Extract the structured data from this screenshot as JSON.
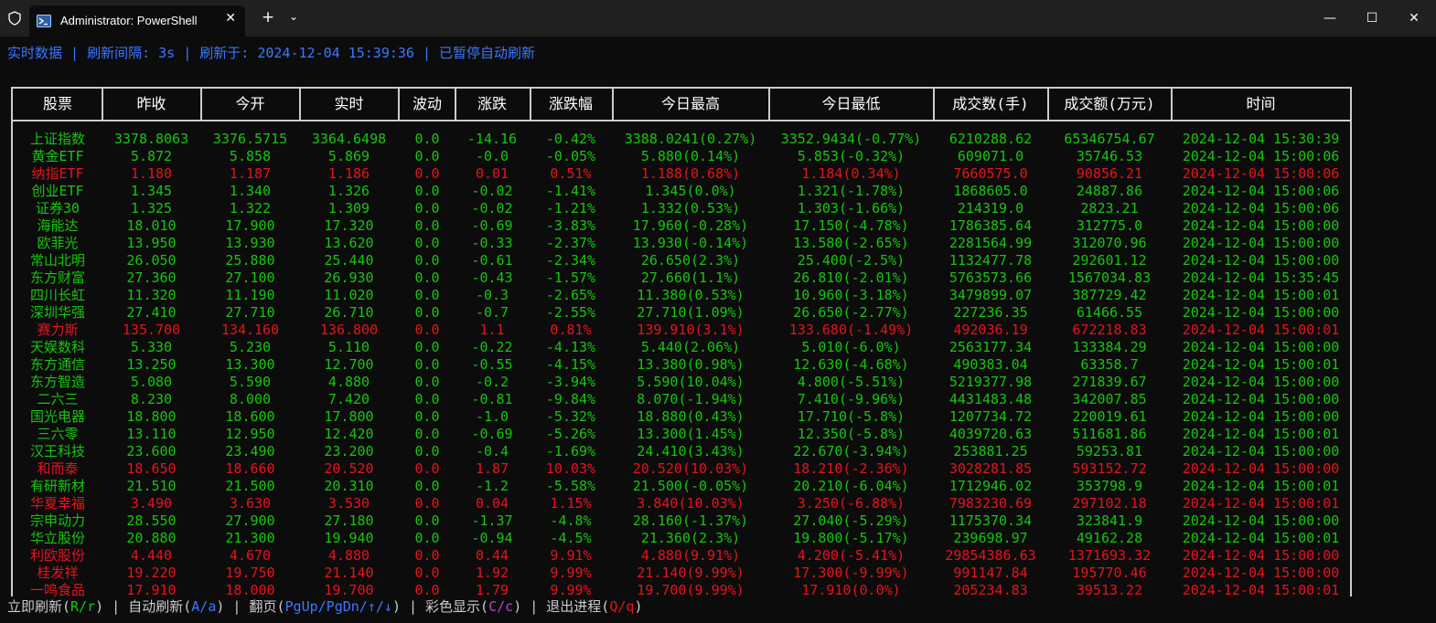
{
  "window": {
    "tab_title": "Administrator: PowerShell",
    "close_tab": "✕",
    "new_tab": "+",
    "dropdown": "⌄",
    "minimize": "—",
    "maximize": "☐",
    "close": "✕",
    "icons": [
      "shield-icon",
      "powershell-icon"
    ]
  },
  "status": {
    "text": "实时数据 | 刷新间隔: 3s | 刷新于: 2024-12-04 15:39:36 | 已暂停自动刷新"
  },
  "colors": {
    "up": "#e5141b",
    "down": "#16c60c",
    "info": "#3b78ff",
    "hotkey_color": "#b148c6"
  },
  "table": {
    "headers": [
      "股票",
      "昨收",
      "今开",
      "实时",
      "波动",
      "涨跌",
      "涨跌幅",
      "今日最高",
      "今日最低",
      "成交数(手)",
      "成交额(万元)",
      "时间"
    ],
    "rows": [
      {
        "trend": "down",
        "cells": [
          "上证指数",
          "3378.8063",
          "3376.5715",
          "3364.6498",
          "0.0",
          "-14.16",
          "-0.42%",
          "3388.0241(0.27%)",
          "3352.9434(-0.77%)",
          "6210288.62",
          "65346754.67",
          "2024-12-04 15:30:39"
        ]
      },
      {
        "trend": "down",
        "cells": [
          "黄金ETF",
          "5.872",
          "5.858",
          "5.869",
          "0.0",
          "-0.0",
          "-0.05%",
          "5.880(0.14%)",
          "5.853(-0.32%)",
          "609071.0",
          "35746.53",
          "2024-12-04 15:00:06"
        ]
      },
      {
        "trend": "up",
        "cells": [
          "纳指ETF",
          "1.180",
          "1.187",
          "1.186",
          "0.0",
          "0.01",
          "0.51%",
          "1.188(0.68%)",
          "1.184(0.34%)",
          "7660575.0",
          "90856.21",
          "2024-12-04 15:00:06"
        ]
      },
      {
        "trend": "down",
        "cells": [
          "创业ETF",
          "1.345",
          "1.340",
          "1.326",
          "0.0",
          "-0.02",
          "-1.41%",
          "1.345(0.0%)",
          "1.321(-1.78%)",
          "1868605.0",
          "24887.86",
          "2024-12-04 15:00:06"
        ]
      },
      {
        "trend": "down",
        "cells": [
          "证券30",
          "1.325",
          "1.322",
          "1.309",
          "0.0",
          "-0.02",
          "-1.21%",
          "1.332(0.53%)",
          "1.303(-1.66%)",
          "214319.0",
          "2823.21",
          "2024-12-04 15:00:06"
        ]
      },
      {
        "trend": "down",
        "cells": [
          "海能达",
          "18.010",
          "17.900",
          "17.320",
          "0.0",
          "-0.69",
          "-3.83%",
          "17.960(-0.28%)",
          "17.150(-4.78%)",
          "1786385.64",
          "312775.0",
          "2024-12-04 15:00:00"
        ]
      },
      {
        "trend": "down",
        "cells": [
          "欧菲光",
          "13.950",
          "13.930",
          "13.620",
          "0.0",
          "-0.33",
          "-2.37%",
          "13.930(-0.14%)",
          "13.580(-2.65%)",
          "2281564.99",
          "312070.96",
          "2024-12-04 15:00:00"
        ]
      },
      {
        "trend": "down",
        "cells": [
          "常山北明",
          "26.050",
          "25.880",
          "25.440",
          "0.0",
          "-0.61",
          "-2.34%",
          "26.650(2.3%)",
          "25.400(-2.5%)",
          "1132477.78",
          "292601.12",
          "2024-12-04 15:00:00"
        ]
      },
      {
        "trend": "down",
        "cells": [
          "东方财富",
          "27.360",
          "27.100",
          "26.930",
          "0.0",
          "-0.43",
          "-1.57%",
          "27.660(1.1%)",
          "26.810(-2.01%)",
          "5763573.66",
          "1567034.83",
          "2024-12-04 15:35:45"
        ]
      },
      {
        "trend": "down",
        "cells": [
          "四川长虹",
          "11.320",
          "11.190",
          "11.020",
          "0.0",
          "-0.3",
          "-2.65%",
          "11.380(0.53%)",
          "10.960(-3.18%)",
          "3479899.07",
          "387729.42",
          "2024-12-04 15:00:01"
        ]
      },
      {
        "trend": "down",
        "cells": [
          "深圳华强",
          "27.410",
          "27.710",
          "26.710",
          "0.0",
          "-0.7",
          "-2.55%",
          "27.710(1.09%)",
          "26.650(-2.77%)",
          "227236.35",
          "61466.55",
          "2024-12-04 15:00:00"
        ]
      },
      {
        "trend": "up",
        "cells": [
          "赛力斯",
          "135.700",
          "134.160",
          "136.800",
          "0.0",
          "1.1",
          "0.81%",
          "139.910(3.1%)",
          "133.680(-1.49%)",
          "492036.19",
          "672218.83",
          "2024-12-04 15:00:01"
        ]
      },
      {
        "trend": "down",
        "cells": [
          "天娱数科",
          "5.330",
          "5.230",
          "5.110",
          "0.0",
          "-0.22",
          "-4.13%",
          "5.440(2.06%)",
          "5.010(-6.0%)",
          "2563177.34",
          "133384.29",
          "2024-12-04 15:00:00"
        ]
      },
      {
        "trend": "down",
        "cells": [
          "东方通信",
          "13.250",
          "13.300",
          "12.700",
          "0.0",
          "-0.55",
          "-4.15%",
          "13.380(0.98%)",
          "12.630(-4.68%)",
          "490383.04",
          "63358.7",
          "2024-12-04 15:00:01"
        ]
      },
      {
        "trend": "down",
        "cells": [
          "东方智造",
          "5.080",
          "5.590",
          "4.880",
          "0.0",
          "-0.2",
          "-3.94%",
          "5.590(10.04%)",
          "4.800(-5.51%)",
          "5219377.98",
          "271839.67",
          "2024-12-04 15:00:00"
        ]
      },
      {
        "trend": "down",
        "cells": [
          "二六三",
          "8.230",
          "8.000",
          "7.420",
          "0.0",
          "-0.81",
          "-9.84%",
          "8.070(-1.94%)",
          "7.410(-9.96%)",
          "4431483.48",
          "342007.85",
          "2024-12-04 15:00:00"
        ]
      },
      {
        "trend": "down",
        "cells": [
          "国光电器",
          "18.800",
          "18.600",
          "17.800",
          "0.0",
          "-1.0",
          "-5.32%",
          "18.880(0.43%)",
          "17.710(-5.8%)",
          "1207734.72",
          "220019.61",
          "2024-12-04 15:00:00"
        ]
      },
      {
        "trend": "down",
        "cells": [
          "三六零",
          "13.110",
          "12.950",
          "12.420",
          "0.0",
          "-0.69",
          "-5.26%",
          "13.300(1.45%)",
          "12.350(-5.8%)",
          "4039720.63",
          "511681.86",
          "2024-12-04 15:00:01"
        ]
      },
      {
        "trend": "down",
        "cells": [
          "汉王科技",
          "23.600",
          "23.490",
          "23.200",
          "0.0",
          "-0.4",
          "-1.69%",
          "24.410(3.43%)",
          "22.670(-3.94%)",
          "253881.25",
          "59253.81",
          "2024-12-04 15:00:00"
        ]
      },
      {
        "trend": "up",
        "cells": [
          "和而泰",
          "18.650",
          "18.660",
          "20.520",
          "0.0",
          "1.87",
          "10.03%",
          "20.520(10.03%)",
          "18.210(-2.36%)",
          "3028281.85",
          "593152.72",
          "2024-12-04 15:00:00"
        ]
      },
      {
        "trend": "down",
        "cells": [
          "有研新材",
          "21.510",
          "21.500",
          "20.310",
          "0.0",
          "-1.2",
          "-5.58%",
          "21.500(-0.05%)",
          "20.210(-6.04%)",
          "1712946.02",
          "353798.9",
          "2024-12-04 15:00:01"
        ]
      },
      {
        "trend": "up",
        "cells": [
          "华夏幸福",
          "3.490",
          "3.630",
          "3.530",
          "0.0",
          "0.04",
          "1.15%",
          "3.840(10.03%)",
          "3.250(-6.88%)",
          "7983230.69",
          "297102.18",
          "2024-12-04 15:00:01"
        ]
      },
      {
        "trend": "down",
        "cells": [
          "宗申动力",
          "28.550",
          "27.900",
          "27.180",
          "0.0",
          "-1.37",
          "-4.8%",
          "28.160(-1.37%)",
          "27.040(-5.29%)",
          "1175370.34",
          "323841.9",
          "2024-12-04 15:00:00"
        ]
      },
      {
        "trend": "down",
        "cells": [
          "华立股份",
          "20.880",
          "21.300",
          "19.940",
          "0.0",
          "-0.94",
          "-4.5%",
          "21.360(2.3%)",
          "19.800(-5.17%)",
          "239698.97",
          "49162.28",
          "2024-12-04 15:00:01"
        ]
      },
      {
        "trend": "up",
        "cells": [
          "利欧股份",
          "4.440",
          "4.670",
          "4.880",
          "0.0",
          "0.44",
          "9.91%",
          "4.880(9.91%)",
          "4.200(-5.41%)",
          "29854386.63",
          "1371693.32",
          "2024-12-04 15:00:00"
        ]
      },
      {
        "trend": "up",
        "cells": [
          "桂发祥",
          "19.220",
          "19.750",
          "21.140",
          "0.0",
          "1.92",
          "9.99%",
          "21.140(9.99%)",
          "17.300(-9.99%)",
          "991147.84",
          "195770.46",
          "2024-12-04 15:00:00"
        ]
      },
      {
        "trend": "up",
        "cells": [
          "一鸣食品",
          "17.910",
          "18.000",
          "19.700",
          "0.0",
          "1.79",
          "9.99%",
          "19.700(9.99%)",
          "17.910(0.0%)",
          "205234.83",
          "39513.22",
          "2024-12-04 15:00:01"
        ]
      }
    ]
  },
  "footer": {
    "refresh_label": "立即刷新(",
    "refresh_key": "R/r",
    "auto_label": ") | 自动刷新(",
    "auto_key": "A/a",
    "page_label": ") | 翻页(",
    "page_key": "PgUp/PgDn/↑/↓",
    "color_label": ") | 彩色显示(",
    "color_key": "C/c",
    "quit_label": ") | 退出进程(",
    "quit_key": "Q/q",
    "end": ")"
  }
}
